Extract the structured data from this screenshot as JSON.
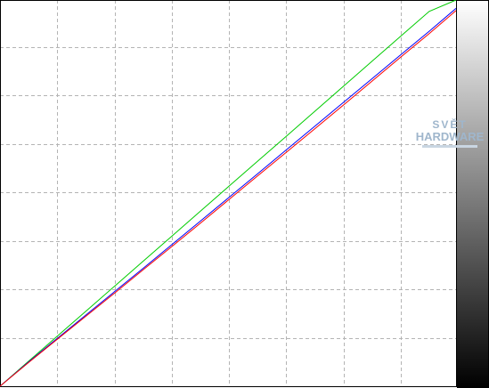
{
  "chart_data": {
    "type": "line",
    "title": "",
    "xlabel": "",
    "ylabel": "",
    "xlim": [
      0,
      255
    ],
    "ylim": [
      0,
      255
    ],
    "x_gridlines": [
      32,
      64,
      96,
      128,
      160,
      192,
      224
    ],
    "y_gridlines": [
      32,
      64,
      96,
      128,
      160,
      192,
      224
    ],
    "grid": true,
    "legend": "none",
    "gradient_bar": {
      "side": "right",
      "from_color": "#ffffff",
      "to_color": "#000000"
    },
    "series": [
      {
        "color": "#00cc00",
        "x": [
          0,
          16,
          32,
          48,
          64,
          80,
          96,
          112,
          128,
          144,
          160,
          176,
          192,
          208,
          224,
          240,
          255
        ],
        "y": [
          0,
          16.5,
          33,
          49.5,
          66,
          82.5,
          99,
          115.5,
          132,
          148.5,
          165,
          181.5,
          198,
          214.5,
          231,
          247.5,
          255
        ]
      },
      {
        "color": "#0000ff",
        "x": [
          0,
          16,
          32,
          48,
          64,
          80,
          96,
          112,
          128,
          144,
          160,
          176,
          192,
          208,
          224,
          240,
          255
        ],
        "y": [
          0,
          16,
          31.6,
          47,
          62.4,
          77.8,
          93.4,
          109,
          124.6,
          140.2,
          156,
          171.6,
          187.4,
          203,
          218.8,
          234.4,
          249.5
        ]
      },
      {
        "color": "#ff0000",
        "x": [
          0,
          16,
          32,
          48,
          64,
          80,
          96,
          112,
          128,
          144,
          160,
          176,
          192,
          208,
          224,
          240,
          255
        ],
        "y": [
          0,
          15.6,
          31,
          46.2,
          61.4,
          76.8,
          92.2,
          107.6,
          123.2,
          138.8,
          154.4,
          170,
          185.6,
          201.4,
          217.2,
          232.8,
          248
        ]
      }
    ]
  },
  "watermark": {
    "line1": "SVĚT",
    "line2": "HARDWARE"
  }
}
